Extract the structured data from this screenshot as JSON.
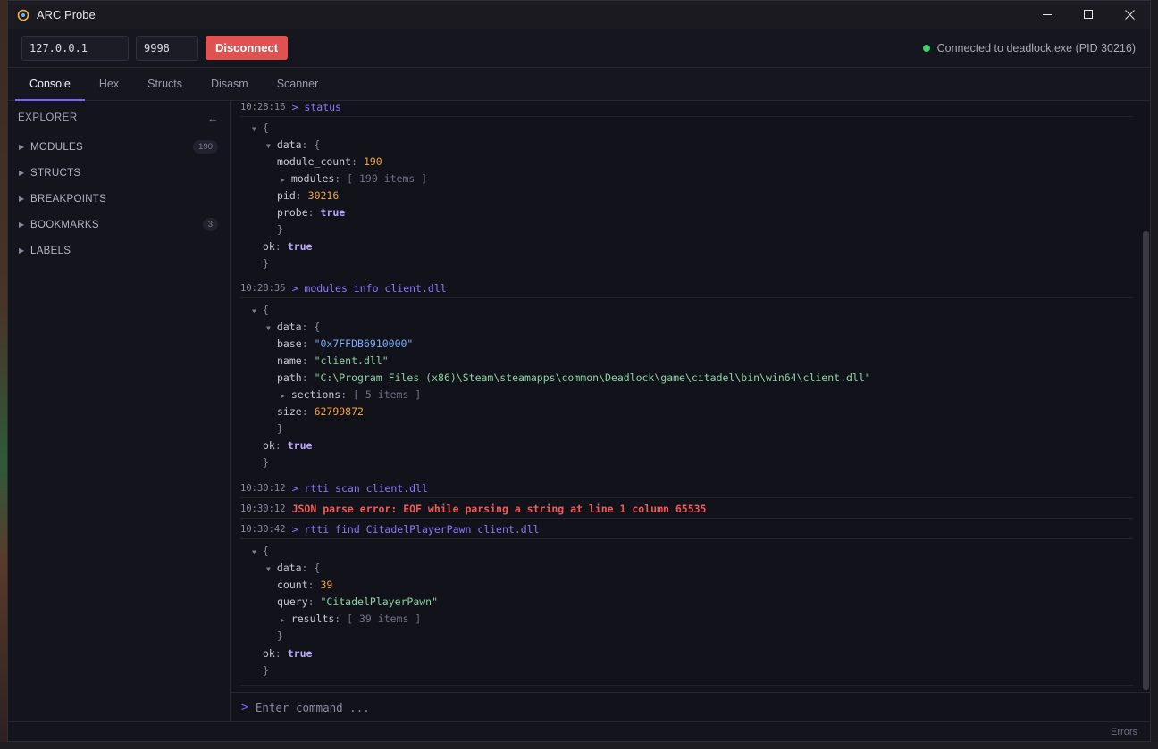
{
  "window": {
    "title": "ARC Probe"
  },
  "connection": {
    "host": "127.0.0.1",
    "port": "9998",
    "disconnect_label": "Disconnect",
    "status_text": "Connected to deadlock.exe (PID 30216)",
    "status_color": "#3ecf6a"
  },
  "tabs": [
    {
      "label": "Console",
      "active": true
    },
    {
      "label": "Hex"
    },
    {
      "label": "Structs"
    },
    {
      "label": "Disasm"
    },
    {
      "label": "Scanner"
    }
  ],
  "sidebar": {
    "title": "EXPLORER",
    "collapse_icon": "←",
    "items": [
      {
        "label": "MODULES",
        "badge": "190"
      },
      {
        "label": "STRUCTS"
      },
      {
        "label": "BREAKPOINTS"
      },
      {
        "label": "BOOKMARKS",
        "badge": "3"
      },
      {
        "label": "LABELS"
      }
    ]
  },
  "console": {
    "entries": [
      {
        "time": "10:28:16",
        "command": "> status"
      },
      {
        "time": "10:28:35",
        "command": "> modules info client.dll"
      },
      {
        "time": "10:30:12",
        "command": "> rtti scan client.dll"
      },
      {
        "time": "10:30:12",
        "error": "JSON parse error: EOF while parsing a string at line 1 column 65535"
      },
      {
        "time": "10:30:42",
        "command": "> rtti find CitadelPlayerPawn client.dll"
      }
    ],
    "status_result": {
      "module_count": "190",
      "modules_meta": "[ 190 items ]",
      "pid": "30216",
      "probe": "true",
      "ok": "true"
    },
    "modules_result": {
      "base": "\"0x7FFDB6910000\"",
      "name": "\"client.dll\"",
      "path": "\"C:\\Program Files (x86)\\Steam\\steamapps\\common\\Deadlock\\game\\citadel\\bin\\win64\\client.dll\"",
      "sections_meta": "[ 5 items ]",
      "size": "62799872",
      "ok": "true"
    },
    "find_result": {
      "count": "39",
      "query": "\"CitadelPlayerPawn\"",
      "results_meta": "[ 39 items ]",
      "ok": "true"
    },
    "input_prompt": ">",
    "input_placeholder": "Enter command ..."
  },
  "statusbar": {
    "errors_label": "Errors"
  },
  "colors": {
    "accent": "#7a62ff",
    "danger": "#e05252",
    "number": "#f0a43a",
    "string": "#8ad4a0",
    "error": "#ef5a5a"
  }
}
